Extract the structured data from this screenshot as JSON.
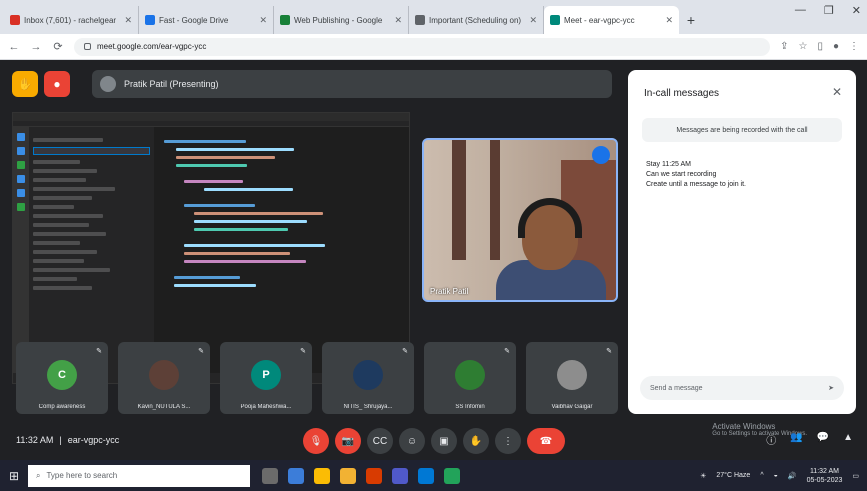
{
  "browser": {
    "tabs": [
      {
        "label": "Inbox (7,601) - rachelgear",
        "color": "#d93025",
        "active": false
      },
      {
        "label": "Fast - Google Drive",
        "color": "#1a73e8",
        "active": false
      },
      {
        "label": "Web Publishing - Google",
        "color": "#188038",
        "active": false
      },
      {
        "label": "Important (Scheduling on)",
        "color": "#5f6368",
        "active": false
      },
      {
        "label": "Meet - ear-vgpc-ycc",
        "color": "#00897b",
        "active": true
      }
    ],
    "url": "meet.google.com/ear-vgpc-ycc"
  },
  "meet": {
    "presenting_label": "Pratik Patil (Presenting)",
    "presenter_name": "Pratik Patil",
    "chat": {
      "title": "In-call messages",
      "notice": "Messages are being recorded with the call",
      "messages": [
        "Stay 11:25 AM",
        "Can we start recording",
        "Create until a message to join it."
      ],
      "input_placeholder": "Send a message"
    },
    "participants": [
      {
        "name": "Comp awareness",
        "initial": "C",
        "color": "#43a047"
      },
      {
        "name": "Kavin_NUTULA S...",
        "initial": "",
        "color": "#5d4037"
      },
      {
        "name": "Pooja Maheshwa...",
        "initial": "P",
        "color": "#00897b"
      },
      {
        "name": "NITIS_ Shrujaya...",
        "initial": "",
        "color": "#1e3a5f"
      },
      {
        "name": "SS Infomin",
        "initial": "",
        "color": "#2e7d32"
      },
      {
        "name": "Vaibhav Gaigar",
        "initial": "",
        "color": "#8d8d8d"
      }
    ],
    "time": "11:32 AM",
    "meeting_code": "ear-vgpc-ycc",
    "activate_title": "Activate Windows",
    "activate_sub": "Go to Settings to activate Windows."
  },
  "taskbar": {
    "search_placeholder": "Type here to search",
    "weather": "27°C Haze",
    "clock_time": "11:32 AM",
    "clock_date": "05-05-2023"
  },
  "colors": {
    "meet_bg": "#202124",
    "accent_red": "#ea4335",
    "accent_yellow": "#f9ab00",
    "accent_blue": "#8ab4f8"
  }
}
